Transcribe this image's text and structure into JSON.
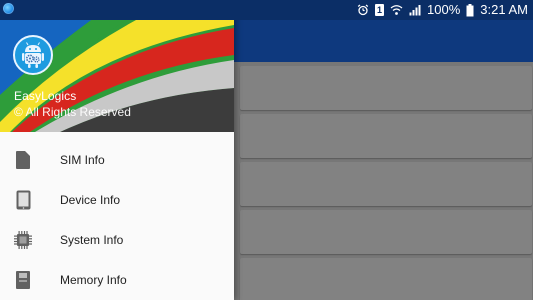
{
  "status_bar": {
    "battery_text": "100%",
    "time": "3:21 AM",
    "sim_badge": "1",
    "icons": [
      "app-notification-icon",
      "alarm-icon",
      "sim-icon",
      "wifi-icon",
      "signal-icon",
      "battery-icon"
    ]
  },
  "drawer": {
    "header": {
      "title": "EasyLogics",
      "subtitle": "© All Rights Reserved",
      "logo_icon": "android-gear-icon",
      "colors": {
        "green": "#2e9d3a",
        "blue": "#1565c0",
        "yellow": "#f5e12a",
        "red": "#d7261e",
        "dark": "#3c3c3c"
      }
    },
    "items": [
      {
        "label": "SIM Info",
        "icon": "sim-card-icon"
      },
      {
        "label": "Device Info",
        "icon": "tablet-icon"
      },
      {
        "label": "System Info",
        "icon": "chip-icon"
      },
      {
        "label": "Memory Info",
        "icon": "memory-icon"
      }
    ]
  },
  "colors": {
    "status_bar": "#0b2e66",
    "toolbar": "#0f3d86",
    "drawer_bg": "#fafafa",
    "scrim_content": "#7f7f7f"
  }
}
